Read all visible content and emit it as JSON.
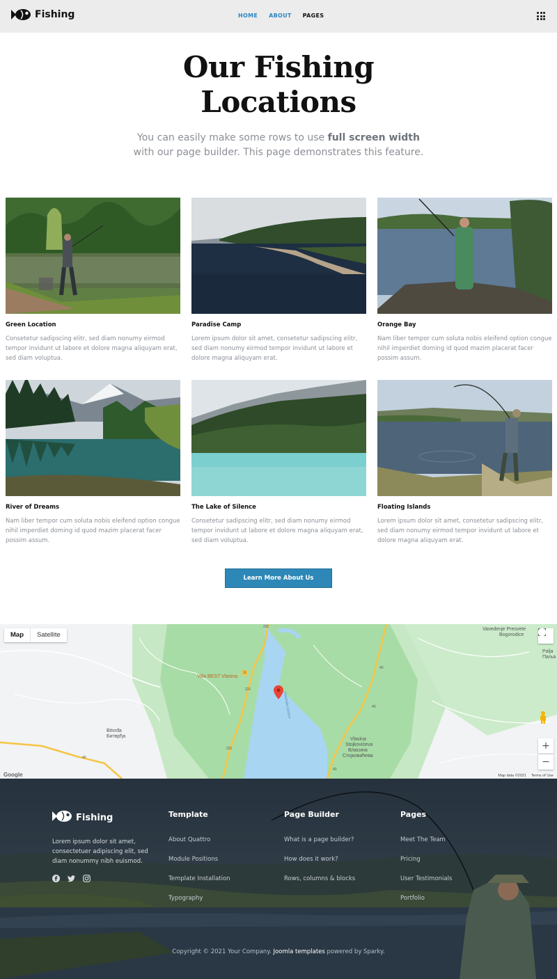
{
  "header": {
    "logo_text": "Fishing",
    "nav": [
      {
        "label": "HOME",
        "active": true
      },
      {
        "label": "ABOUT",
        "active": true
      },
      {
        "label": "PAGES",
        "active": false
      }
    ]
  },
  "hero": {
    "title_line1": "Our Fishing",
    "title_line2": "Locations",
    "subtitle_before": "You can easily make some rows to use ",
    "subtitle_bold": "full screen width",
    "subtitle_after": " with our page builder. This page demonstrates this feature."
  },
  "cards": [
    {
      "title": "Green Location",
      "text": "Consetetur sadipscing elitr, sed diam nonumy eirmod tempor invidunt ut labore et dolore magna aliquyam erat, sed diam voluptua."
    },
    {
      "title": "Paradise Camp",
      "text": "Lorem ipsum dolor sit amet, consetetur sadipscing elitr, sed diam nonumy eirmod tempor invidunt ut labore et dolore magna aliquyam erat."
    },
    {
      "title": "Orange Bay",
      "text": "Nam liber tempor cum soluta nobis eleifend option congue nihil imperdiet doming id quod mazim placerat facer possim assum."
    },
    {
      "title": "River of Dreams",
      "text": "Nam liber tempor cum soluta nobis eleifend option congue nihil imperdiet doming id quod mazim placerat facer possim assum."
    },
    {
      "title": "The Lake of Silence",
      "text": "Consetetur sadipscing elitr, sed diam nonumy eirmod tempor invidunt ut labore et dolore magna aliquyam erat, sed diam voluptua."
    },
    {
      "title": "Floating Islands",
      "text": "Lorem ipsum dolor sit amet, consetetur sadipscing elitr, sed diam nonumy eirmod tempor invidunt ut labore et dolore magna aliquyam erat."
    }
  ],
  "cta_label": "Learn More About Us",
  "map": {
    "type_map": "Map",
    "type_satellite": "Satellite",
    "labels": {
      "villa": "Villa BEST Vlasina",
      "bitvrda_lat": "Bitvrđa",
      "bitvrda_cyr": "Битврђа",
      "vlasina_1": "Vlasina",
      "vlasina_2": "Stojkovićeva",
      "vlasina_3": "Власина",
      "vlasina_4": "Стојковићева",
      "church_1": "Vavedenje Presvete",
      "church_2": "Bogorodice",
      "palja_lat": "Palja",
      "palja_cyr": "Паља",
      "lake": "Vlasinsko jezero",
      "road_231": "231",
      "road_40": "40",
      "road_11": "11"
    },
    "google": "Google",
    "map_data": "Map data ©2021",
    "terms": "Terms of Use",
    "zoom_in": "+",
    "zoom_out": "−"
  },
  "footer": {
    "logo_text": "Fishing",
    "about": "Lorem ipsum dolor sit amet, consectetuer adipiscing elit, sed diam nonummy nibh euismod.",
    "columns": [
      {
        "title": "Template",
        "links": [
          "About Quattro",
          "Module Positions",
          "Template Installation",
          "Typography"
        ]
      },
      {
        "title": "Page Builder",
        "links": [
          "What is a page builder?",
          "How does it work?",
          "Rows, columns & blocks"
        ]
      },
      {
        "title": "Pages",
        "links": [
          "Meet The Team",
          "Pricing",
          "User Testimonials",
          "Portfolio"
        ]
      }
    ],
    "copyright_before": "Copyright © 2021 Your Company. ",
    "copyright_link": "Joomla templates",
    "copyright_after": " powered by Sparky."
  },
  "colors": {
    "accent": "#2a86c2",
    "button": "#2e88b7",
    "header_bg": "#ececec",
    "footer_overlay": "#2a3540"
  },
  "icons": [
    "fish-logo-icon",
    "grid-menu-icon",
    "facebook-icon",
    "twitter-icon",
    "instagram-icon",
    "map-pin-icon",
    "fullscreen-icon",
    "pegman-icon"
  ]
}
